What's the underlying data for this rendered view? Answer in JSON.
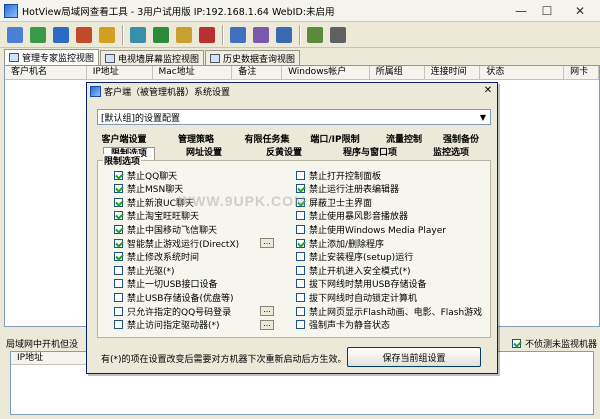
{
  "window": {
    "title": "HotView局域网查看工具 - 3用户试用版 IP:192.168.1.64 WebID:未启用"
  },
  "toolbar": {
    "icons": [
      "grid-icon",
      "monitor-icon",
      "doc-icon",
      "person-icon",
      "users-icon",
      "network-icon",
      "chart-icon",
      "key-icon",
      "lock-icon",
      "search-icon",
      "settings-icon",
      "window-icon",
      "bars-icon",
      "print-icon"
    ]
  },
  "tabs": [
    {
      "label": "管理专家监控视图"
    },
    {
      "label": "电视墙屏幕监控视图"
    },
    {
      "label": "历史数据查询视图"
    }
  ],
  "grid": {
    "columns": [
      "客户机名",
      "IP地址",
      "Mac地址",
      "备注",
      "Windows帐户",
      "所属组",
      "连接时间",
      "状态",
      "网卡"
    ]
  },
  "bottom": {
    "label": "局域网中开机但没",
    "checkbox_label": "不侦测未监视机器",
    "list_header": "IP地址"
  },
  "dialog": {
    "title": "客户端（被管理机器）系统设置",
    "select_value": "[默认组]的设置配置",
    "tabs_row1": [
      "客户端设置",
      "管理策略",
      "有限任务集",
      "端口/IP限制",
      "流量控制",
      "强制备份"
    ],
    "tabs_row2": [
      "限制选项",
      "网址设置",
      "反黄设置",
      "程序与窗口项",
      "监控选项"
    ],
    "group_label": "限制选项",
    "left_options": [
      {
        "label": "禁止QQ聊天",
        "checked": true
      },
      {
        "label": "禁止MSN聊天",
        "checked": true
      },
      {
        "label": "禁止新浪UC聊天",
        "checked": true
      },
      {
        "label": "禁止淘宝旺旺聊天",
        "checked": true
      },
      {
        "label": "禁止中国移动飞信聊天",
        "checked": true
      },
      {
        "label": "智能禁止游戏运行(DirectX)",
        "checked": true
      },
      {
        "label": "禁止修改系统时间",
        "checked": true
      },
      {
        "label": "禁止光驱(*)",
        "checked": false
      },
      {
        "label": "禁止一切USB接口设备",
        "checked": false
      },
      {
        "label": "禁止USB存储设备(优盘等)",
        "checked": false
      },
      {
        "label": "只允许指定的QQ号码登录",
        "checked": false
      },
      {
        "label": "禁止访问指定驱动器(*)",
        "checked": false
      }
    ],
    "right_options": [
      {
        "label": "禁止打开控制面板",
        "checked": false
      },
      {
        "label": "禁止运行注册表编辑器",
        "checked": true
      },
      {
        "label": "屏蔽卫士主界面",
        "checked": true
      },
      {
        "label": "禁止使用暴风影音播放器",
        "checked": false
      },
      {
        "label": "禁止使用Windows Media Player",
        "checked": false
      },
      {
        "label": "禁止添加/删除程序",
        "checked": true
      },
      {
        "label": "禁止安装程序(setup)运行",
        "checked": false
      },
      {
        "label": "禁止开机进入安全模式(*)",
        "checked": false
      },
      {
        "label": "拔下网线时禁用USB存储设备",
        "checked": false
      },
      {
        "label": "拔下网线时自动锁定计算机",
        "checked": false
      },
      {
        "label": "禁止网页显示Flash动画、电影、Flash游戏",
        "checked": false
      },
      {
        "label": "强制声卡为静音状态",
        "checked": false
      }
    ],
    "note": "有(*)的项在设置改变后需要对方机器下次重新启动后方生效。",
    "save_label": "保存当前组设置"
  },
  "watermark": "WWW.9UPK.COM",
  "colors": {
    "accent": "#0a246a",
    "check": "#21a121"
  }
}
